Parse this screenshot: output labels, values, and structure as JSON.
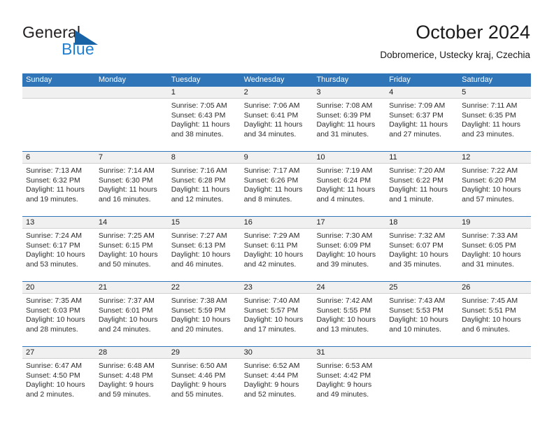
{
  "brand": {
    "name_top": "General",
    "name_bottom": "Blue",
    "triangle_color": "#1763a5",
    "blue": "#1f7fd0"
  },
  "header": {
    "title": "October 2024",
    "subtitle": "Dobromerice, Ustecky kraj, Czechia"
  },
  "colors": {
    "header_blue": "#3075b8",
    "day_band": "#f0f0f0",
    "grid_line": "#cfcfcf"
  },
  "weekdays": [
    "Sunday",
    "Monday",
    "Tuesday",
    "Wednesday",
    "Thursday",
    "Friday",
    "Saturday"
  ],
  "weeks": [
    [
      {
        "day": "",
        "lines": []
      },
      {
        "day": "",
        "lines": []
      },
      {
        "day": "1",
        "lines": [
          "Sunrise: 7:05 AM",
          "Sunset: 6:43 PM",
          "Daylight: 11 hours",
          "and 38 minutes."
        ]
      },
      {
        "day": "2",
        "lines": [
          "Sunrise: 7:06 AM",
          "Sunset: 6:41 PM",
          "Daylight: 11 hours",
          "and 34 minutes."
        ]
      },
      {
        "day": "3",
        "lines": [
          "Sunrise: 7:08 AM",
          "Sunset: 6:39 PM",
          "Daylight: 11 hours",
          "and 31 minutes."
        ]
      },
      {
        "day": "4",
        "lines": [
          "Sunrise: 7:09 AM",
          "Sunset: 6:37 PM",
          "Daylight: 11 hours",
          "and 27 minutes."
        ]
      },
      {
        "day": "5",
        "lines": [
          "Sunrise: 7:11 AM",
          "Sunset: 6:35 PM",
          "Daylight: 11 hours",
          "and 23 minutes."
        ]
      }
    ],
    [
      {
        "day": "6",
        "lines": [
          "Sunrise: 7:13 AM",
          "Sunset: 6:32 PM",
          "Daylight: 11 hours",
          "and 19 minutes."
        ]
      },
      {
        "day": "7",
        "lines": [
          "Sunrise: 7:14 AM",
          "Sunset: 6:30 PM",
          "Daylight: 11 hours",
          "and 16 minutes."
        ]
      },
      {
        "day": "8",
        "lines": [
          "Sunrise: 7:16 AM",
          "Sunset: 6:28 PM",
          "Daylight: 11 hours",
          "and 12 minutes."
        ]
      },
      {
        "day": "9",
        "lines": [
          "Sunrise: 7:17 AM",
          "Sunset: 6:26 PM",
          "Daylight: 11 hours",
          "and 8 minutes."
        ]
      },
      {
        "day": "10",
        "lines": [
          "Sunrise: 7:19 AM",
          "Sunset: 6:24 PM",
          "Daylight: 11 hours",
          "and 4 minutes."
        ]
      },
      {
        "day": "11",
        "lines": [
          "Sunrise: 7:20 AM",
          "Sunset: 6:22 PM",
          "Daylight: 11 hours",
          "and 1 minute."
        ]
      },
      {
        "day": "12",
        "lines": [
          "Sunrise: 7:22 AM",
          "Sunset: 6:20 PM",
          "Daylight: 10 hours",
          "and 57 minutes."
        ]
      }
    ],
    [
      {
        "day": "13",
        "lines": [
          "Sunrise: 7:24 AM",
          "Sunset: 6:17 PM",
          "Daylight: 10 hours",
          "and 53 minutes."
        ]
      },
      {
        "day": "14",
        "lines": [
          "Sunrise: 7:25 AM",
          "Sunset: 6:15 PM",
          "Daylight: 10 hours",
          "and 50 minutes."
        ]
      },
      {
        "day": "15",
        "lines": [
          "Sunrise: 7:27 AM",
          "Sunset: 6:13 PM",
          "Daylight: 10 hours",
          "and 46 minutes."
        ]
      },
      {
        "day": "16",
        "lines": [
          "Sunrise: 7:29 AM",
          "Sunset: 6:11 PM",
          "Daylight: 10 hours",
          "and 42 minutes."
        ]
      },
      {
        "day": "17",
        "lines": [
          "Sunrise: 7:30 AM",
          "Sunset: 6:09 PM",
          "Daylight: 10 hours",
          "and 39 minutes."
        ]
      },
      {
        "day": "18",
        "lines": [
          "Sunrise: 7:32 AM",
          "Sunset: 6:07 PM",
          "Daylight: 10 hours",
          "and 35 minutes."
        ]
      },
      {
        "day": "19",
        "lines": [
          "Sunrise: 7:33 AM",
          "Sunset: 6:05 PM",
          "Daylight: 10 hours",
          "and 31 minutes."
        ]
      }
    ],
    [
      {
        "day": "20",
        "lines": [
          "Sunrise: 7:35 AM",
          "Sunset: 6:03 PM",
          "Daylight: 10 hours",
          "and 28 minutes."
        ]
      },
      {
        "day": "21",
        "lines": [
          "Sunrise: 7:37 AM",
          "Sunset: 6:01 PM",
          "Daylight: 10 hours",
          "and 24 minutes."
        ]
      },
      {
        "day": "22",
        "lines": [
          "Sunrise: 7:38 AM",
          "Sunset: 5:59 PM",
          "Daylight: 10 hours",
          "and 20 minutes."
        ]
      },
      {
        "day": "23",
        "lines": [
          "Sunrise: 7:40 AM",
          "Sunset: 5:57 PM",
          "Daylight: 10 hours",
          "and 17 minutes."
        ]
      },
      {
        "day": "24",
        "lines": [
          "Sunrise: 7:42 AM",
          "Sunset: 5:55 PM",
          "Daylight: 10 hours",
          "and 13 minutes."
        ]
      },
      {
        "day": "25",
        "lines": [
          "Sunrise: 7:43 AM",
          "Sunset: 5:53 PM",
          "Daylight: 10 hours",
          "and 10 minutes."
        ]
      },
      {
        "day": "26",
        "lines": [
          "Sunrise: 7:45 AM",
          "Sunset: 5:51 PM",
          "Daylight: 10 hours",
          "and 6 minutes."
        ]
      }
    ],
    [
      {
        "day": "27",
        "lines": [
          "Sunrise: 6:47 AM",
          "Sunset: 4:50 PM",
          "Daylight: 10 hours",
          "and 2 minutes."
        ]
      },
      {
        "day": "28",
        "lines": [
          "Sunrise: 6:48 AM",
          "Sunset: 4:48 PM",
          "Daylight: 9 hours",
          "and 59 minutes."
        ]
      },
      {
        "day": "29",
        "lines": [
          "Sunrise: 6:50 AM",
          "Sunset: 4:46 PM",
          "Daylight: 9 hours",
          "and 55 minutes."
        ]
      },
      {
        "day": "30",
        "lines": [
          "Sunrise: 6:52 AM",
          "Sunset: 4:44 PM",
          "Daylight: 9 hours",
          "and 52 minutes."
        ]
      },
      {
        "day": "31",
        "lines": [
          "Sunrise: 6:53 AM",
          "Sunset: 4:42 PM",
          "Daylight: 9 hours",
          "and 49 minutes."
        ]
      },
      {
        "day": "",
        "lines": []
      },
      {
        "day": "",
        "lines": []
      }
    ]
  ]
}
